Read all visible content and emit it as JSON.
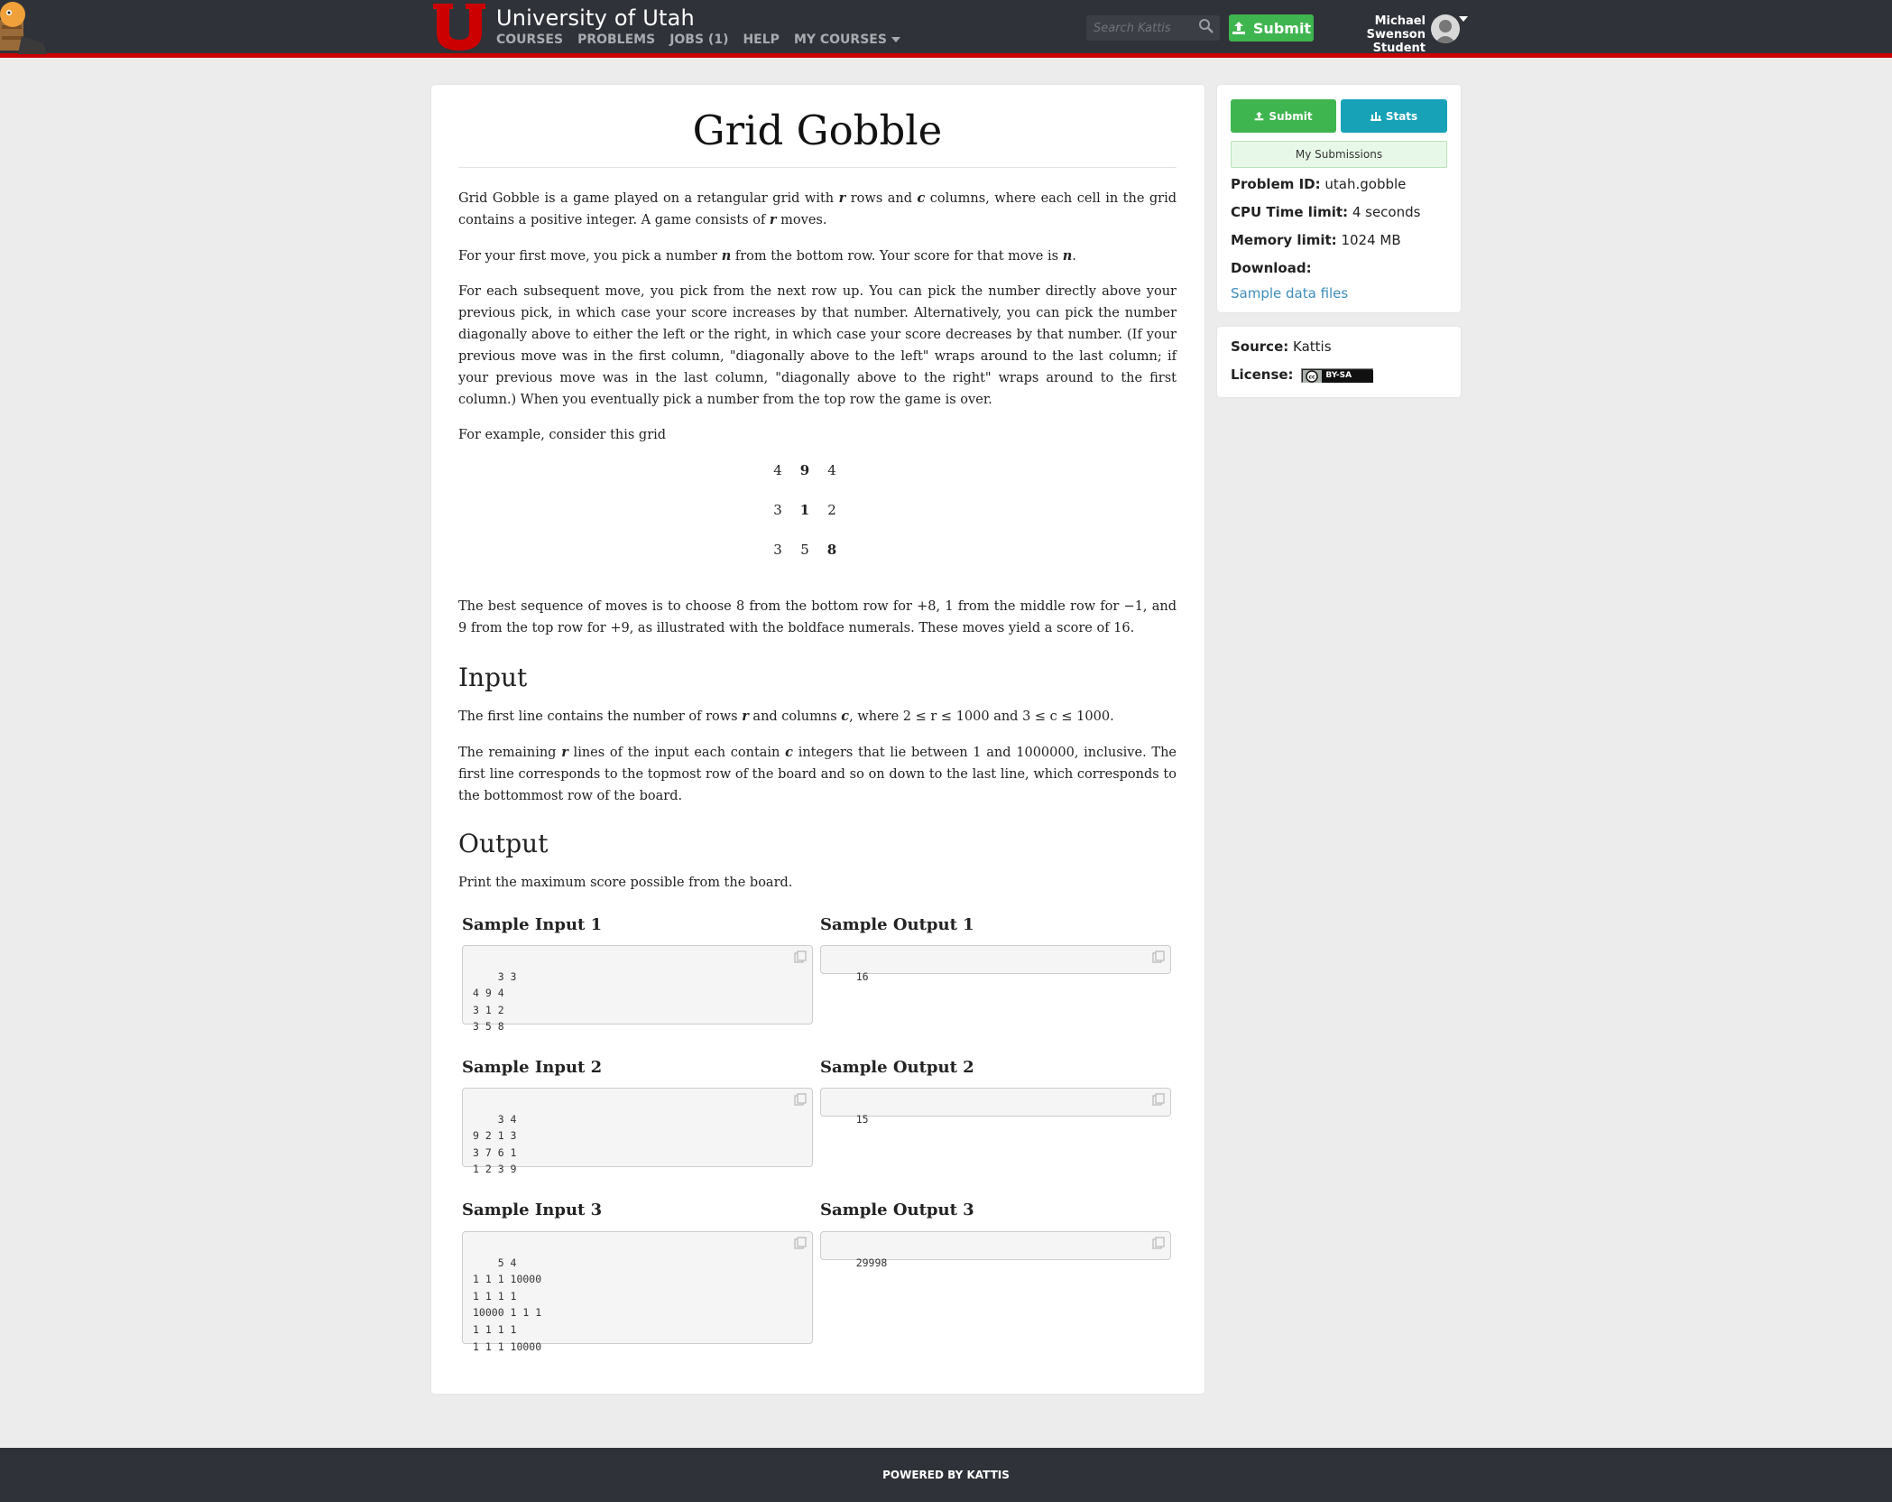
{
  "nav": {
    "institution": "University of Utah",
    "links": [
      "COURSES",
      "PROBLEMS",
      "JOBS (1)",
      "HELP",
      "MY COURSES"
    ],
    "search_placeholder": "Search Kattis",
    "submit_label": "Submit",
    "user_name": "Michael Swenson",
    "user_role": "Student"
  },
  "problem": {
    "title": "Grid Gobble",
    "p1a": "Grid Gobble is a game played on a retangular grid with ",
    "p1b": " rows and ",
    "p1c": " columns, where each cell in the grid contains a positive integer. A game consists of ",
    "p1d": " moves.",
    "p2a": "For your first move, you pick a number ",
    "p2b": " from the bottom row. Your score for that move is ",
    "p2c": ".",
    "p3": "For each subsequent move, you pick from the next row up. You can pick the number directly above your previous pick, in which case your score increases by that number. Alternatively, you can pick the number diagonally above to either the left or the right, in which case your score decreases by that number. (If your previous move was in the first column, \"diagonally above to the left\" wraps around to the last column; if your previous move was in the last column, \"diagonally above to the right\" wraps around to the first column.) When you eventually pick a number from the top row the game is over.",
    "p4": "For example, consider this grid",
    "grid": [
      [
        "4",
        "9",
        "4"
      ],
      [
        "3",
        "1",
        "2"
      ],
      [
        "3",
        "5",
        "8"
      ]
    ],
    "p5a": "The best sequence of moves is to choose 8 from the bottom row for ",
    "p5b": ", 1 from the middle row for ",
    "p5c": ", and 9 from the top row for ",
    "p5d": ", as illustrated with the boldface numerals. These moves yield a score of 16.",
    "input_heading": "Input",
    "in1a": "The first line contains the number of rows ",
    "in1b": " and columns ",
    "in1c": ", where ",
    "in1d": " and ",
    "in1e": ".",
    "in2a": "The remaining ",
    "in2b": " lines of the input each contain ",
    "in2c": " integers that lie between 1 and 1000000, inclusive. The first line corresponds to the topmost row of the board and so on down to the last line, which corresponds to the bottommost row of the board.",
    "output_heading": "Output",
    "out1": "Print the maximum score possible from the board.",
    "var_r": "r",
    "var_c": "c",
    "var_n": "n",
    "plus8": "+8",
    "minus1": "−1",
    "plus9": "+9",
    "range_r": "2 ≤ r ≤ 1000",
    "range_c": "3 ≤ c ≤ 1000"
  },
  "samples": [
    {
      "in_label": "Sample Input 1",
      "out_label": "Sample Output 1",
      "input": "3 3\n4 9 4\n3 1 2\n3 5 8",
      "output": "16"
    },
    {
      "in_label": "Sample Input 2",
      "out_label": "Sample Output 2",
      "input": "3 4\n9 2 1 3\n3 7 6 1\n1 2 3 9",
      "output": "15"
    },
    {
      "in_label": "Sample Input 3",
      "out_label": "Sample Output 3",
      "input": "5 4\n1 1 1 10000\n1 1 1 1\n10000 1 1 1\n1 1 1 1\n1 1 1 10000",
      "output": "29998"
    }
  ],
  "sidebar": {
    "submit_label": "Submit",
    "stats_label": "Stats",
    "my_submissions": "My Submissions",
    "problem_id_label": "Problem ID:",
    "problem_id": "utah.gobble",
    "cpu_label": "CPU Time limit:",
    "cpu_value": "4 seconds",
    "memory_label": "Memory limit:",
    "memory_value": "1024 MB",
    "download_label": "Download:",
    "download_link": "Sample data files",
    "source_label": "Source:",
    "source_value": "Kattis",
    "license_label": "License:",
    "license_badge": "BY-SA"
  },
  "footer": {
    "text": "POWERED BY KATTIS"
  },
  "colors": {
    "brand_red": "#cc0000",
    "submit_green": "#3fb550",
    "stats_teal": "#17a2b8",
    "navbar": "#2f3238"
  }
}
